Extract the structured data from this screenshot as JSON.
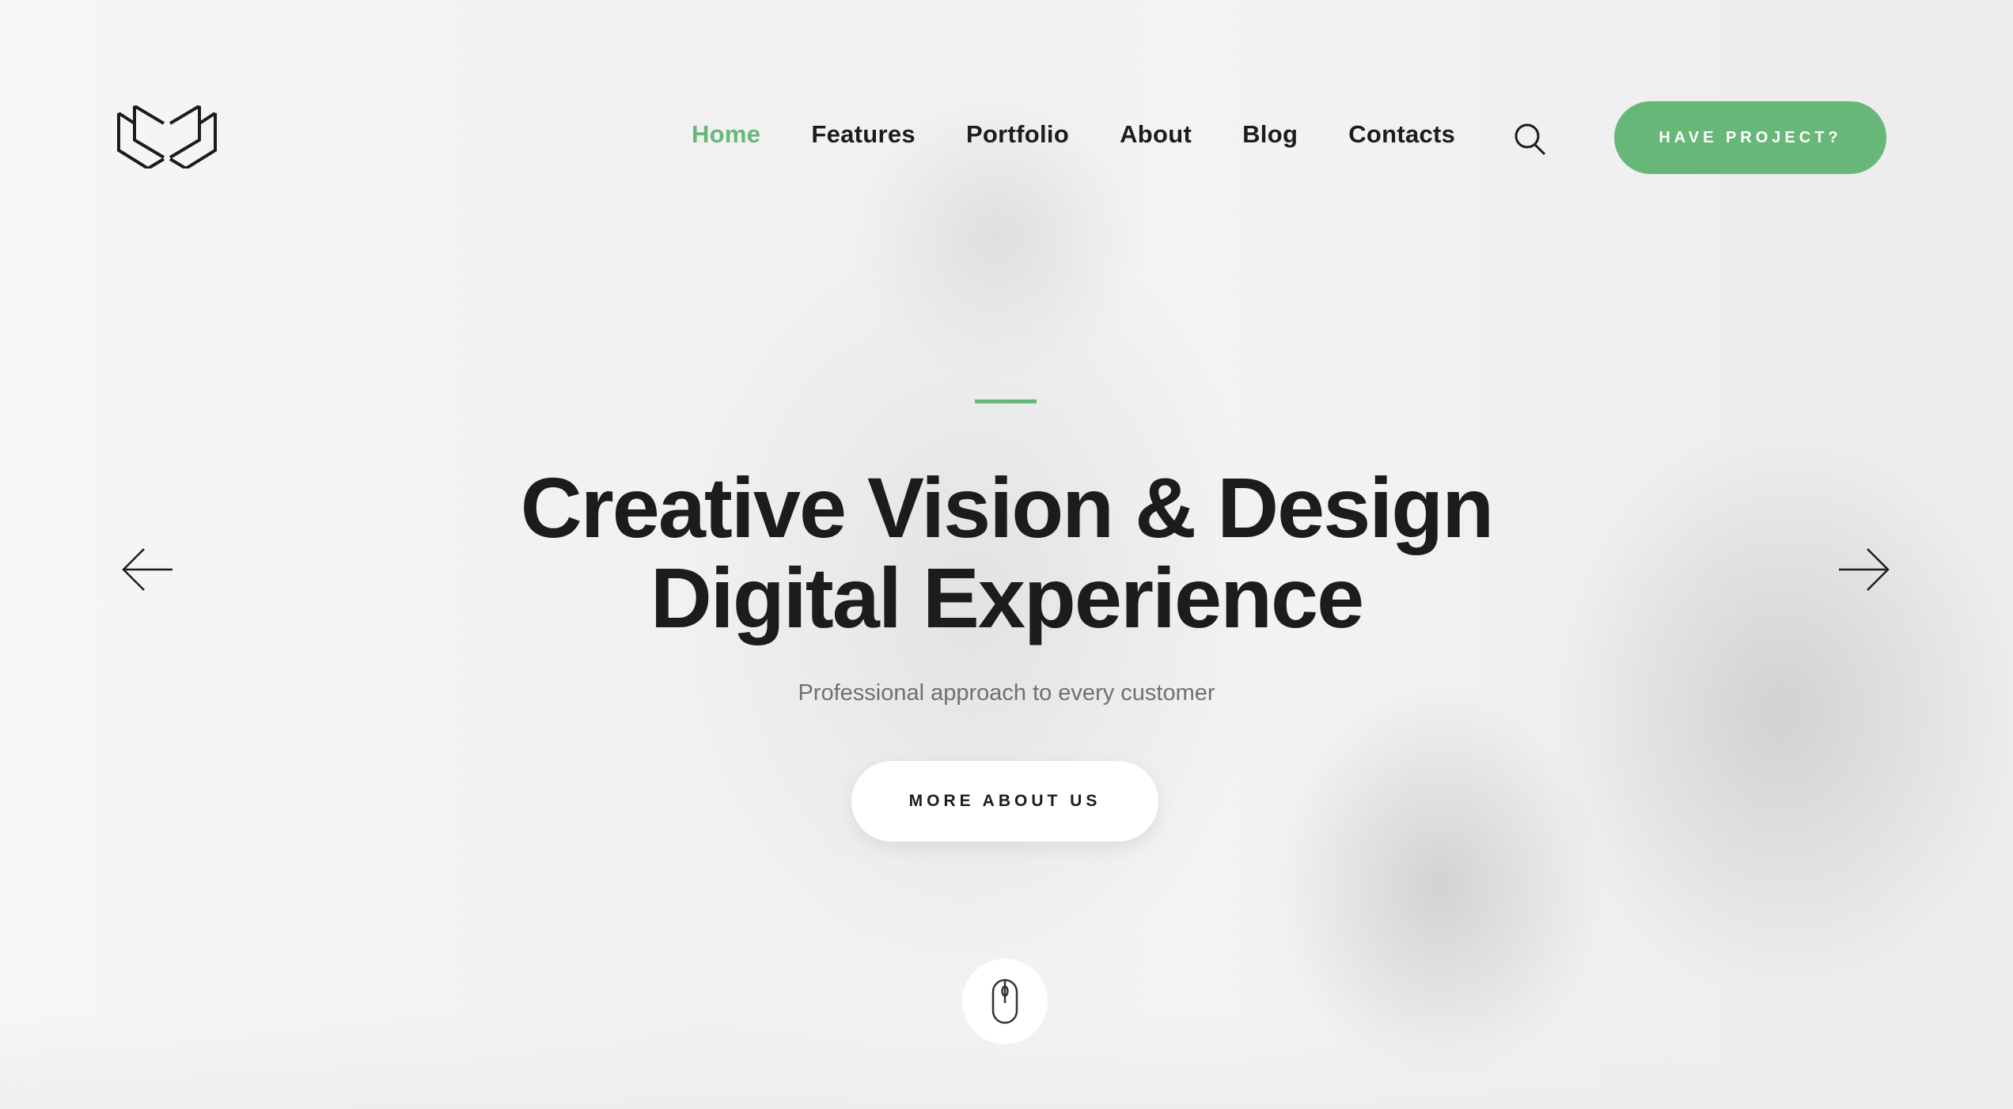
{
  "brand": {
    "logo_icon": "book-logo-icon",
    "accent_color": "#67b878",
    "text_color": "#1c1c1e"
  },
  "nav": {
    "items": [
      {
        "label": "Home",
        "active": true
      },
      {
        "label": "Features",
        "active": false
      },
      {
        "label": "Portfolio",
        "active": false
      },
      {
        "label": "About",
        "active": false
      },
      {
        "label": "Blog",
        "active": false
      },
      {
        "label": "Contacts",
        "active": false
      }
    ],
    "search_icon": "search-icon",
    "cta_label": "HAVE PROJECT?"
  },
  "hero": {
    "title_line1": "Creative Vision & Design",
    "title_line2": "Digital Experience",
    "subtitle": "Professional approach to every customer",
    "button_label": "MORE ABOUT US",
    "prev_icon": "arrow-left-icon",
    "next_icon": "arrow-right-icon",
    "scroll_icon": "mouse-scroll-icon"
  }
}
